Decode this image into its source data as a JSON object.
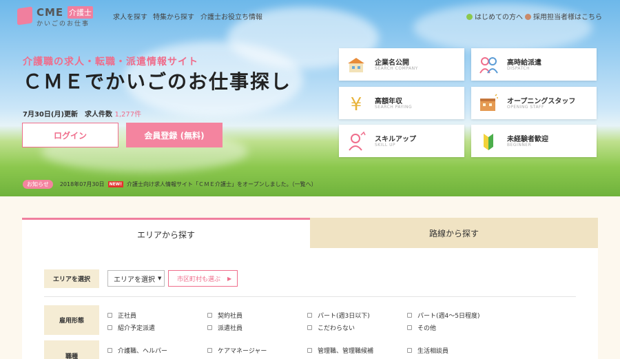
{
  "header": {
    "logo_cme": "CME",
    "logo_kaigo": "介護士",
    "logo_sub": "かいごのお仕事",
    "nav": [
      "求人を探す",
      "特集から探す",
      "介護士お役立ち情報"
    ],
    "right_links": [
      "はじめての方へ",
      "採用担当者様はこちら"
    ]
  },
  "hero": {
    "tagline": "介護職の求人・転職・派遣情報サイト",
    "headline": "ＣＭＥでかいごのお仕事探し",
    "updated": "7月30日(月)更新　求人件数",
    "count": "1,277件",
    "login_label": "ログイン",
    "register_label": "会員登録 (無料)"
  },
  "tiles": [
    {
      "title": "企業名公開",
      "sub": "SEARCH COMPANY",
      "icon": "company-building-icon"
    },
    {
      "title": "高時給派遣",
      "sub": "DISPATCH",
      "icon": "dispatch-people-icon"
    },
    {
      "title": "高額年収",
      "sub": "SEARCH PAYING",
      "icon": "yen-icon"
    },
    {
      "title": "オープニングスタッフ",
      "sub": "OPENING STAFF",
      "icon": "opening-house-icon"
    },
    {
      "title": "スキルアップ",
      "sub": "SKILL UP",
      "icon": "skillup-person-icon"
    },
    {
      "title": "未経験者歓迎",
      "sub": "BEGINNER",
      "icon": "beginner-mark-icon"
    }
  ],
  "news": {
    "badge": "お知らせ",
    "date": "2018年07月30日",
    "new_label": "NEW!",
    "text": "介護士向け求人情報サイト「ＣＭＥ介護士」をオープンしました。（一覧へ）"
  },
  "search": {
    "tabs": [
      "エリアから探す",
      "路線から探す"
    ],
    "area_label": "エリアを選択",
    "area_select": "エリアを選択",
    "city_button": "市区町村も選ぶ",
    "employment_label": "雇用形態",
    "employment_options": [
      "正社員",
      "契約社員",
      "パート(週3日以下)",
      "パート(週4〜5日程度)",
      "紹介予定派遣",
      "派遣社員",
      "こだわらない",
      "その他"
    ],
    "job_label": "職種",
    "job_options": [
      "介護職、ヘルパー",
      "ケアマネージャー",
      "管理職、管理職候補",
      "生活相談員"
    ]
  },
  "colors": {
    "accent_pink": "#f07f9e",
    "tab_beige": "#f0e3c3",
    "label_bg": "#f5ecd4"
  }
}
